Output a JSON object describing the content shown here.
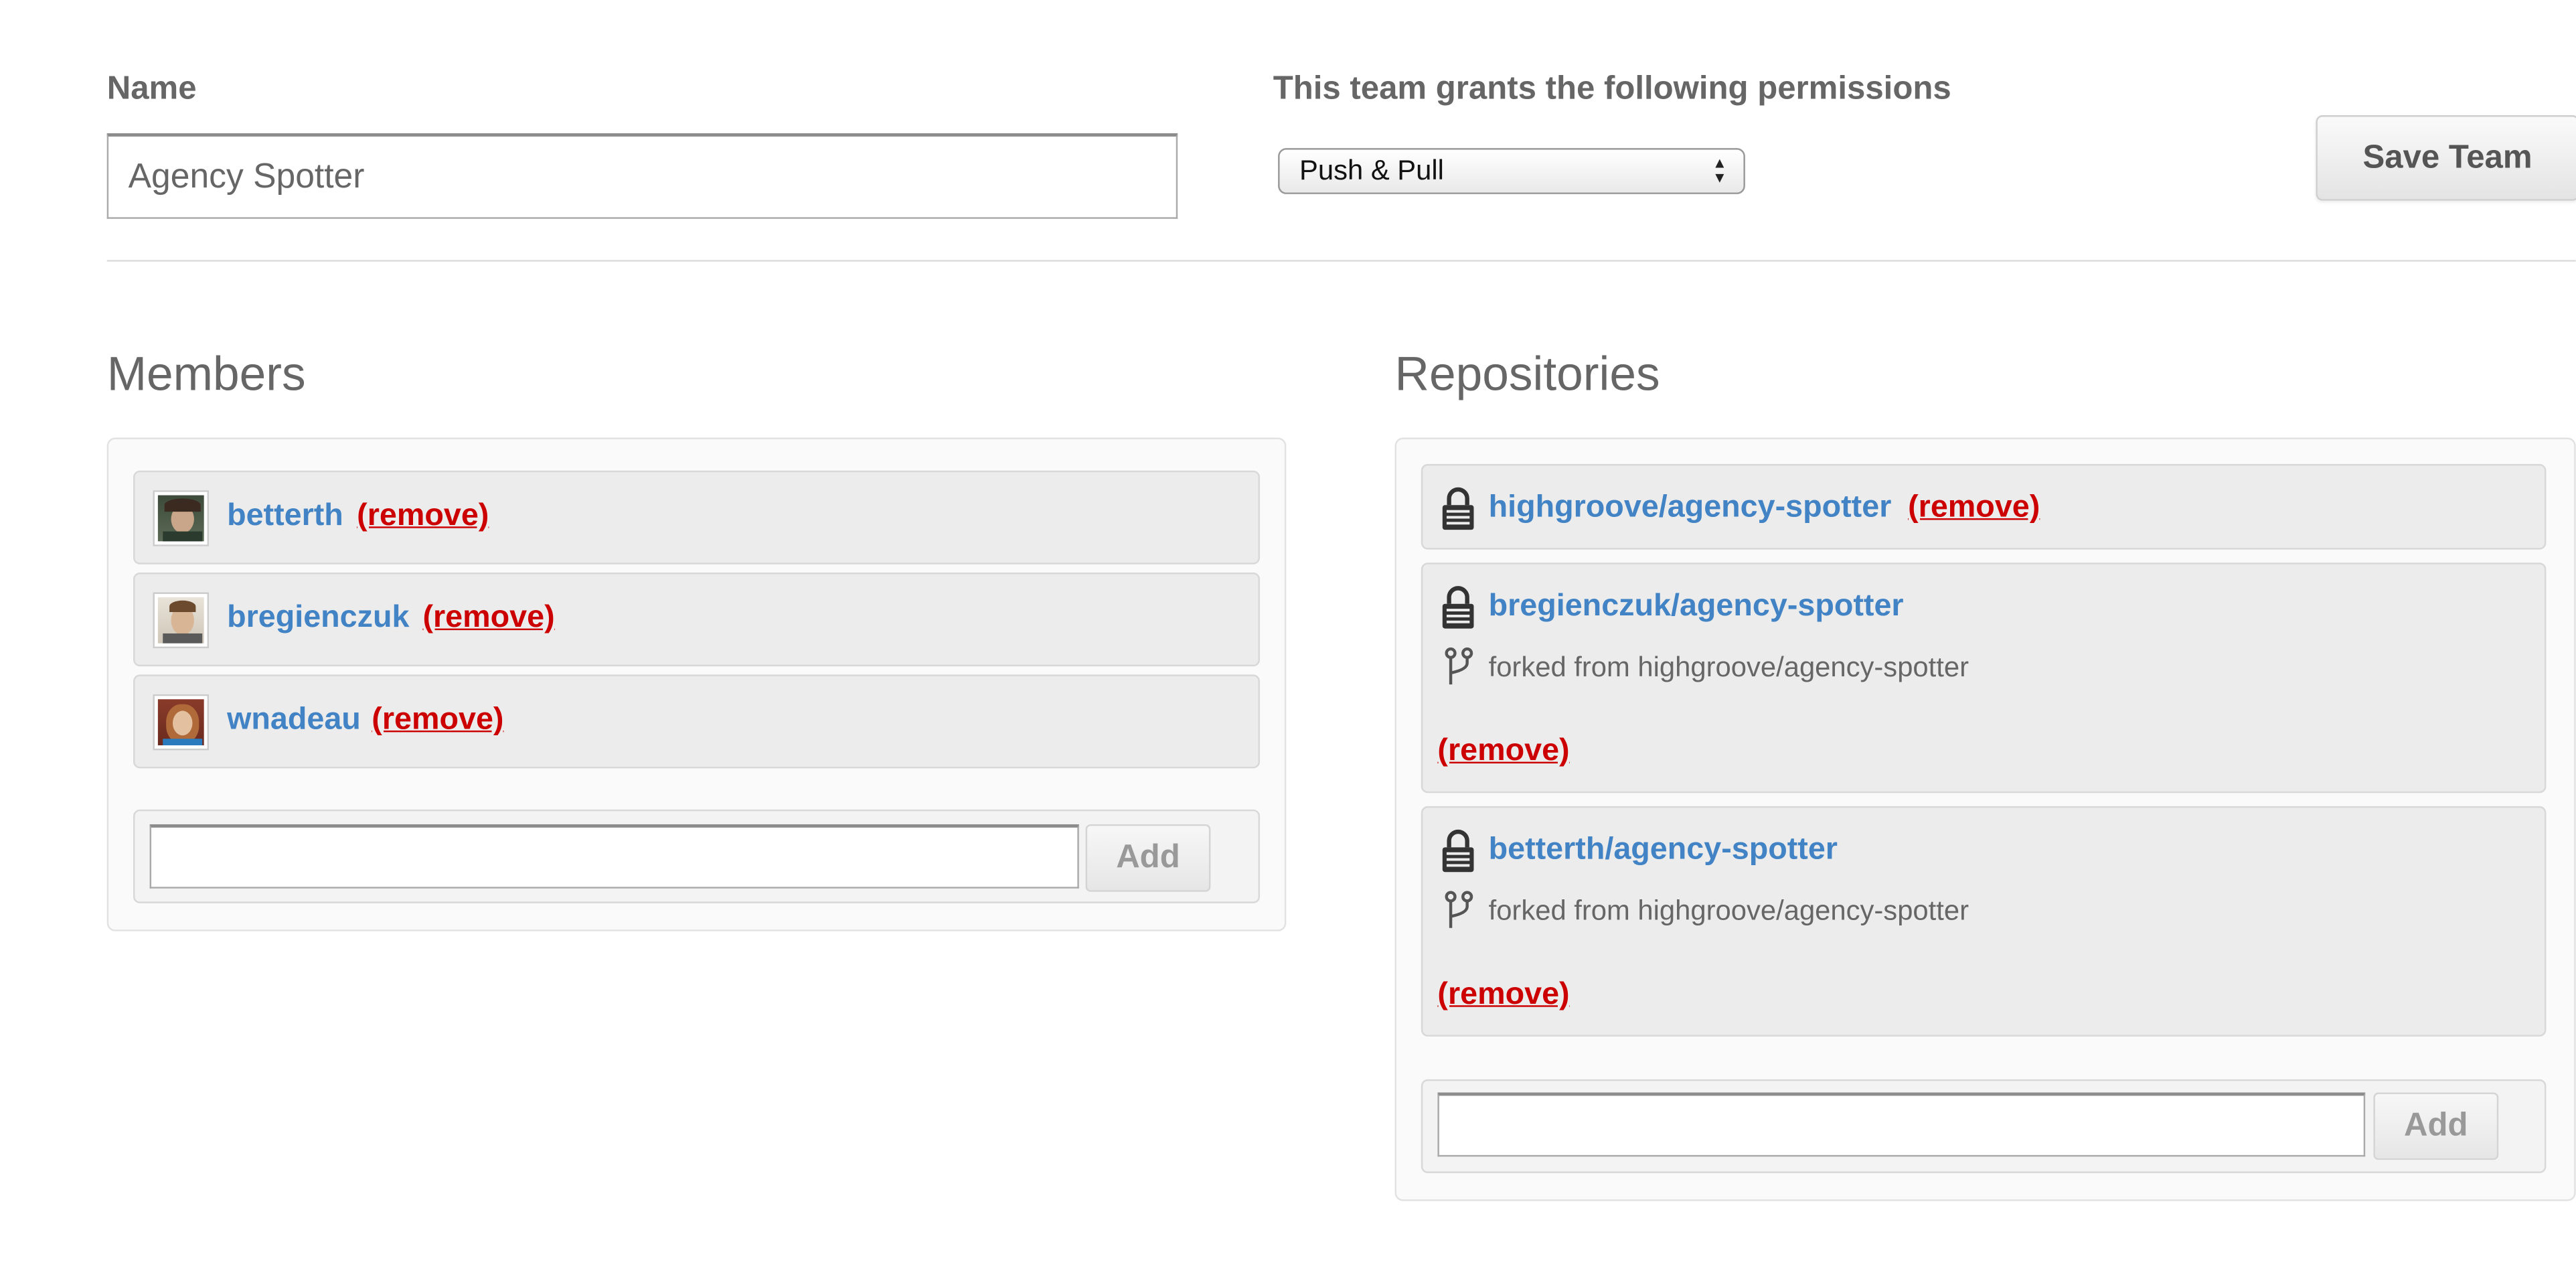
{
  "form": {
    "name_label": "Name",
    "name_value": "Agency Spotter",
    "permissions_label": "This team grants the following permissions",
    "permission_selected": "Push & Pull",
    "save_label": "Save Team"
  },
  "members": {
    "title": "Members",
    "items": [
      {
        "username": "betterth",
        "remove_label": "(remove)"
      },
      {
        "username": "bregienczuk",
        "remove_label": "(remove)"
      },
      {
        "username": "wnadeau",
        "remove_label": "(remove)"
      }
    ],
    "add_value": "",
    "add_label": "Add"
  },
  "repositories": {
    "title": "Repositories",
    "items": [
      {
        "name": "highgroove/agency-spotter",
        "remove_label": "(remove)",
        "private": true
      },
      {
        "name": "bregienczuk/agency-spotter",
        "fork_text": "forked from highgroove/agency-spotter",
        "remove_label": "(remove)",
        "private": true
      },
      {
        "name": "betterth/agency-spotter",
        "fork_text": "forked from highgroove/agency-spotter",
        "remove_label": "(remove)",
        "private": true
      }
    ],
    "add_value": "",
    "add_label": "Add"
  },
  "colors": {
    "link": "#4183c4",
    "remove": "#cc0000"
  }
}
